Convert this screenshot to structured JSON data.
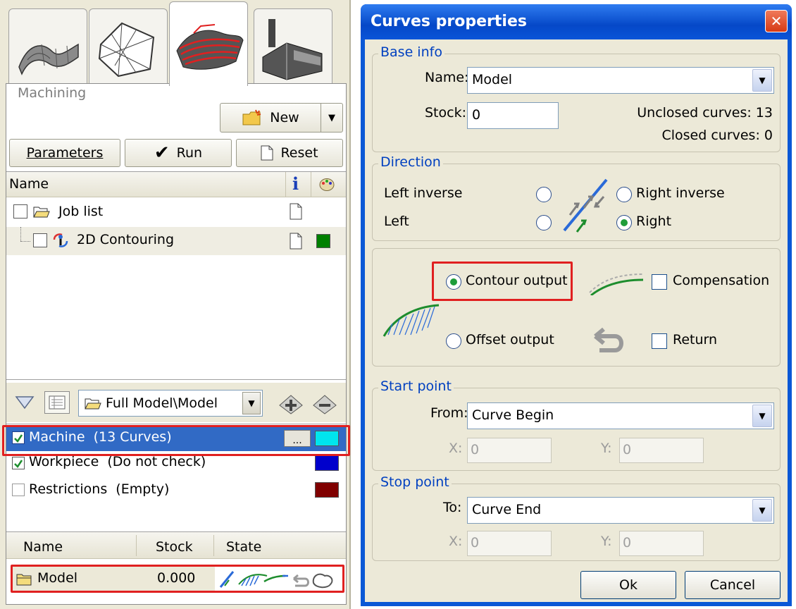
{
  "left": {
    "panel_title": "Machining",
    "new_label": "New",
    "parameters_label": "Parameters",
    "run_label": "Run",
    "reset_label": "Reset",
    "job_header": {
      "name": "Name",
      "info_glyph": "i"
    },
    "jobs": [
      {
        "label": "Job list"
      },
      {
        "label": "2D Contouring",
        "color": "#008000"
      }
    ],
    "geometry_path": "Full Model\\Model",
    "geometry_items": [
      {
        "label": "Machine  (13 Curves)",
        "checked": true,
        "selected": true,
        "more_label": "...",
        "color": "#00e5ee"
      },
      {
        "label": "Workpiece  (Do not check)",
        "checked": true,
        "selected": false,
        "color": "#0000cc"
      },
      {
        "label": "Restrictions  (Empty)",
        "checked": false,
        "selected": false,
        "color": "#800000"
      }
    ],
    "curves_table": {
      "headers": [
        "Name",
        "Stock",
        "State"
      ],
      "rows": [
        {
          "name": "Model",
          "stock": "0.000"
        }
      ]
    }
  },
  "dialog": {
    "title": "Curves properties",
    "close_glyph": "✕",
    "base_info": {
      "legend": "Base info",
      "name_label": "Name:",
      "name_value": "Model",
      "stock_label": "Stock:",
      "stock_value": "0",
      "unclosed": "Unclosed curves: 13",
      "closed": "Closed curves: 0"
    },
    "direction": {
      "legend": "Direction",
      "left_inverse": "Left inverse",
      "left": "Left",
      "right_inverse": "Right inverse",
      "right": "Right",
      "selected": "Right"
    },
    "output": {
      "contour": "Contour output",
      "offset": "Offset output",
      "compensation": "Compensation",
      "return": "Return",
      "selected": "Contour output"
    },
    "start_point": {
      "legend": "Start point",
      "from_label": "From:",
      "from_value": "Curve Begin",
      "x_label": "X:",
      "x_value": "0",
      "y_label": "Y:",
      "y_value": "0"
    },
    "stop_point": {
      "legend": "Stop point",
      "to_label": "To:",
      "to_value": "Curve End",
      "x_label": "X:",
      "x_value": "0",
      "y_label": "Y:",
      "y_value": "0"
    },
    "ok_label": "Ok",
    "cancel_label": "Cancel"
  }
}
